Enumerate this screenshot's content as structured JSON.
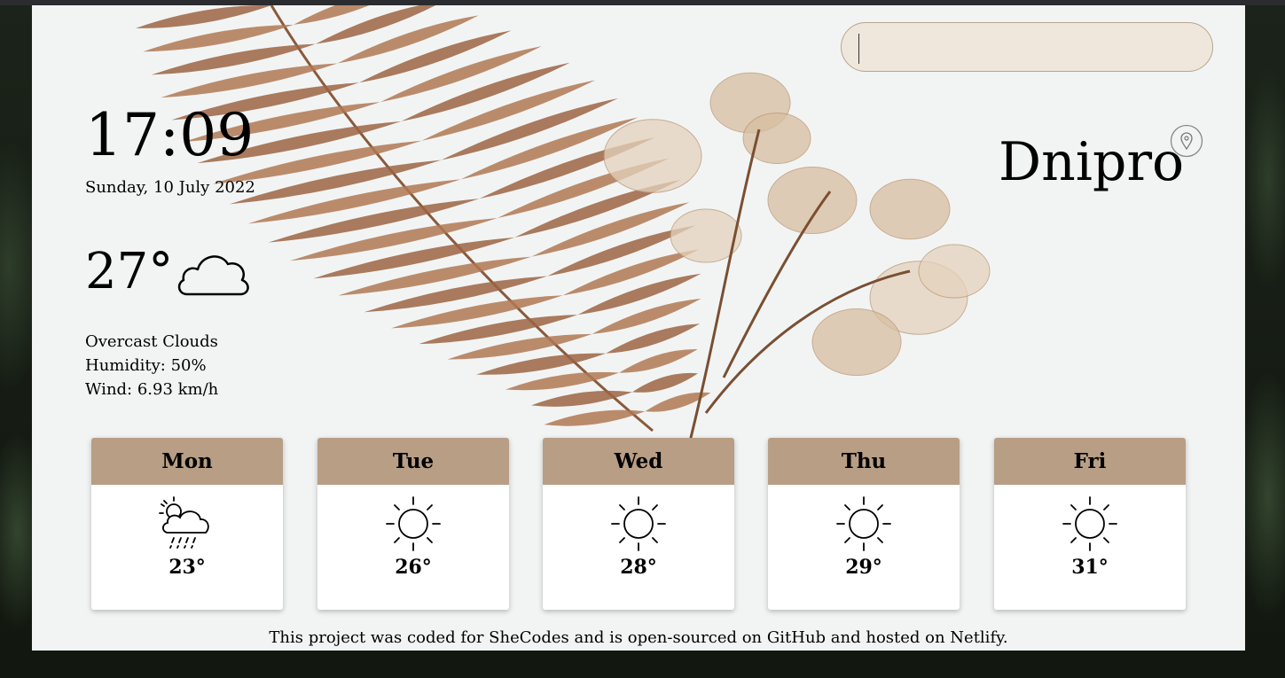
{
  "search": {
    "value": "",
    "placeholder": ""
  },
  "clock": {
    "time": "17:09",
    "date": "Sunday, 10 July 2022"
  },
  "current": {
    "temperature": "27°",
    "icon": "cloud-icon",
    "description": "Overcast Clouds",
    "humidity": "Humidity: 50%",
    "wind": "Wind: 6.93 km/h"
  },
  "location": {
    "city": "Dnipro",
    "icon": "location-pin-icon"
  },
  "forecast": [
    {
      "day": "Mon",
      "icon": "sun-cloud-rain-icon",
      "temp": "23°"
    },
    {
      "day": "Tue",
      "icon": "sun-icon",
      "temp": "26°"
    },
    {
      "day": "Wed",
      "icon": "sun-icon",
      "temp": "28°"
    },
    {
      "day": "Thu",
      "icon": "sun-icon",
      "temp": "29°"
    },
    {
      "day": "Fri",
      "icon": "sun-icon",
      "temp": "31°"
    }
  ],
  "footer": {
    "text": "This project was coded for SheCodes and is open-sourced on GitHub and hosted on Netlify."
  },
  "colors": {
    "day_header": "#b89e85",
    "search_bg": "#efe7dc",
    "card_bg": "#f2f4f4"
  }
}
